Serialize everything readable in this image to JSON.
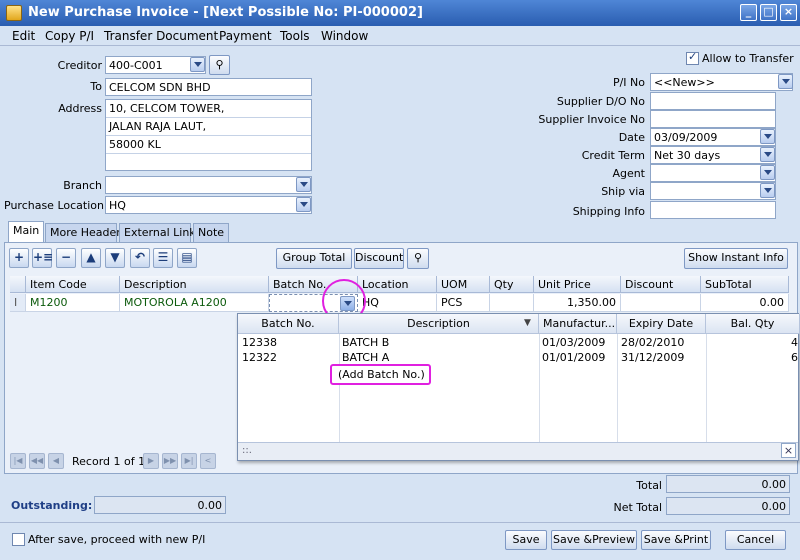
{
  "window": {
    "title": "New Purchase Invoice - [Next Possible No: PI-000002]"
  },
  "menu": [
    "Edit",
    "Copy P/I",
    "Transfer Document",
    "Payment",
    "Tools",
    "Window"
  ],
  "header_left": {
    "creditor_label": "Creditor",
    "creditor_value": "400-C001",
    "to_label": "To",
    "to_value": "CELCOM SDN BHD",
    "address_label": "Address",
    "address_lines": [
      "10, CELCOM TOWER,",
      "JALAN RAJA LAUT,",
      "58000 KL",
      ""
    ],
    "branch_label": "Branch",
    "branch_value": "",
    "purchase_location_label": "Purchase Location",
    "purchase_location_value": "HQ"
  },
  "header_right": {
    "allow_transfer_label": "Allow to Transfer",
    "allow_transfer_checked": true,
    "pi_no_label": "P/I  No",
    "pi_no_value": "<<New>>",
    "supplier_do_label": "Supplier D/O No",
    "supplier_do_value": "",
    "supplier_invoice_label": "Supplier Invoice No",
    "supplier_invoice_value": "",
    "date_label": "Date",
    "date_value": "03/09/2009",
    "credit_term_label": "Credit Term",
    "credit_term_value": "Net 30 days",
    "agent_label": "Agent",
    "agent_value": "",
    "ship_via_label": "Ship via",
    "ship_via_value": "",
    "shipping_info_label": "Shipping Info",
    "shipping_info_value": ""
  },
  "tabs": [
    "Main",
    "More Header",
    "External Link",
    "Note"
  ],
  "toolbar": {
    "group_total": "Group Total",
    "discount": "Discount",
    "show_instant_info": "Show Instant Info"
  },
  "grid": {
    "headers": [
      "Item Code",
      "Description",
      "Batch No.",
      "Location",
      "UOM",
      "Qty",
      "Unit Price",
      "Discount",
      "SubTotal"
    ],
    "row": {
      "indicator": "I",
      "item_code": "M1200",
      "description": "MOTOROLA A1200",
      "batch_no": "",
      "location": "HQ",
      "uom": "PCS",
      "qty": "",
      "unit_price": "1,350.00",
      "discount": "",
      "subtotal": "0.00"
    }
  },
  "batch_popup": {
    "headers": [
      "Batch No.",
      "Description",
      "Manufactur...",
      "Expiry Date",
      "Bal. Qty"
    ],
    "rows": [
      {
        "batch_no": "12338",
        "description": "BATCH B",
        "manufactured": "01/03/2009",
        "expiry": "28/02/2010",
        "bal_qty": "4"
      },
      {
        "batch_no": "12322",
        "description": "BATCH A",
        "manufactured": "01/01/2009",
        "expiry": "31/12/2009",
        "bal_qty": "6"
      }
    ],
    "add_batch": "(Add Batch No.)",
    "footer_dots": "::."
  },
  "navigator": {
    "record_text": "Record 1 of 1"
  },
  "footer": {
    "outstanding_label": "Outstanding:",
    "outstanding_value": "0.00",
    "total_label": "Total",
    "total_value": "0.00",
    "net_total_label": "Net Total",
    "net_total_value": "0.00",
    "after_save_label": "After save, proceed with new P/I",
    "save": "Save",
    "save_preview": "Save &Preview",
    "save_print": "Save &Print",
    "cancel": "Cancel"
  },
  "colors": {
    "accent": "#2a5db0",
    "highlight": "#e020e0",
    "outstanding_label": "#1f3f86"
  }
}
